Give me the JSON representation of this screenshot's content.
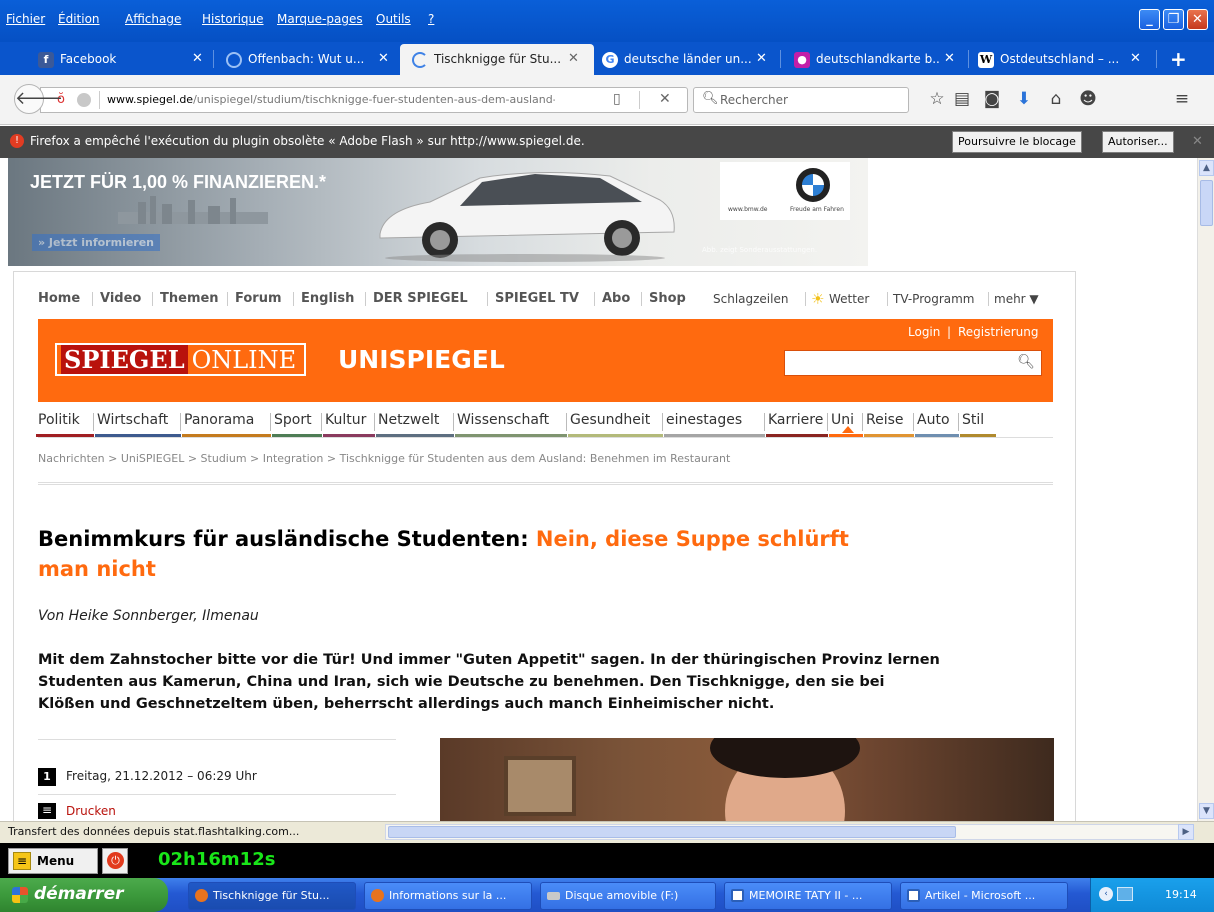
{
  "menubar": {
    "items": [
      "Fichier",
      "Édition",
      "Affichage",
      "Historique",
      "Marque-pages",
      "Outils",
      "?"
    ]
  },
  "tabs": [
    {
      "label": "Facebook",
      "icon": "facebook-icon"
    },
    {
      "label": "Offenbach: Wut u...",
      "icon": "loading-icon"
    },
    {
      "label": "Tischknigge für Stu...",
      "icon": "loading-icon"
    },
    {
      "label": "deutsche länder un...",
      "icon": "google-icon"
    },
    {
      "label": "deutschlandkarte b...",
      "icon": "flickr-icon"
    },
    {
      "label": "Ostdeutschland – ...",
      "icon": "wikipedia-icon"
    }
  ],
  "navbar": {
    "url_domain": "www.spiegel.de",
    "url_path": "/unispiegel/studium/tischknigge-fuer-studenten-aus-dem-ausland-l",
    "search_placeholder": "Rechercher"
  },
  "notification": {
    "message": "Firefox a empêché l'exécution du plugin obsolète « Adobe Flash » sur http://www.spiegel.de.",
    "continue_label": "Poursuivre le blocage",
    "allow_label": "Autoriser..."
  },
  "ad": {
    "headline": "JETZT FÜR 1,00 % FINANZIEREN.*",
    "cta": "» Jetzt informieren",
    "disclaimer": "Abb. zeigt Sonderausstattungen.",
    "brand_url": "www.bmw.de",
    "brand_tagline": "Freude am Fahren"
  },
  "site": {
    "top_nav": [
      "Home",
      "Video",
      "Themen",
      "Forum",
      "English",
      "DER SPIEGEL",
      "SPIEGEL TV",
      "Abo",
      "Shop"
    ],
    "schlagzeilen": "Schlagzeilen",
    "wetter": "Wetter",
    "tv": "TV-Programm",
    "mehr": "mehr ▼",
    "login": "Login",
    "register": "Registrierung",
    "logo_spiegel": "SPIEGEL",
    "logo_online": "ONLINE",
    "logo_section": "UNISPIEGEL",
    "categories": [
      {
        "label": "Politik",
        "color": "#a01e22"
      },
      {
        "label": "Wirtschaft",
        "color": "#3d5a8e"
      },
      {
        "label": "Panorama",
        "color": "#c47b1e"
      },
      {
        "label": "Sport",
        "color": "#4e7d55"
      },
      {
        "label": "Kultur",
        "color": "#8a3a5e"
      },
      {
        "label": "Netzwelt",
        "color": "#5d6e80"
      },
      {
        "label": "Wissenschaft",
        "color": "#7f9470"
      },
      {
        "label": "Gesundheit",
        "color": "#b3ba7a"
      },
      {
        "label": "einestages",
        "color": "#a5a5a5"
      },
      {
        "label": "Karriere",
        "color": "#8a2420"
      },
      {
        "label": "Uni",
        "color": "#ff6a0f"
      },
      {
        "label": "Reise",
        "color": "#e09432"
      },
      {
        "label": "Auto",
        "color": "#6f8fb0"
      },
      {
        "label": "Stil",
        "color": "#b08a2e"
      }
    ],
    "breadcrumb": "Nachrichten > UniSPIEGEL > Studium > Integration > Tischknigge für Studenten aus dem Ausland: Benehmen im Restaurant"
  },
  "article": {
    "title_black": "Benimmkurs für ausländische Studenten:",
    "title_orange_1": "Nein, diese Suppe schlürft",
    "title_orange_2": "man nicht",
    "author": "Von Heike Sonnberger, Ilmenau",
    "lead_1": "Mit dem Zahnstocher bitte vor die Tür! Und immer \"Guten Appetit\" sagen. In der thüringischen Provinz lernen",
    "lead_2": "Studenten aus Kamerun, China und Iran, sich wie Deutsche zu benehmen. Den Tischknigge, den sie bei",
    "lead_3": "Klößen und Geschnetzeltem üben, beherrscht allerdings auch manch Einheimischer nicht.",
    "date_badge": "1",
    "date": "Freitag, 21.12.2012 – 06:29 Uhr",
    "print": "Drucken"
  },
  "statusbar": {
    "text": "Transfert des données depuis stat.flashtalking.com..."
  },
  "timer": {
    "menu_label": "Menu",
    "elapsed": "02h16m12s"
  },
  "taskbar": {
    "start": "démarrer",
    "buttons": [
      {
        "label": "Tischknigge für Stu...",
        "color": "#e8731f"
      },
      {
        "label": "Informations sur la ...",
        "color": "#e8731f"
      },
      {
        "label": "Disque amovible (F:)",
        "color": "#c9c9c9"
      },
      {
        "label": "MEMOIRE TATY II - ...",
        "color": "#2b5fb8"
      },
      {
        "label": "Artikel - Microsoft ...",
        "color": "#2b5fb8"
      }
    ],
    "clock": "19:14"
  },
  "colors": {
    "spiegel_orange": "#ff6a0f",
    "xp_blue": "#0a55cc",
    "start_green": "#3c9a3c",
    "timer_green": "#19e619"
  }
}
